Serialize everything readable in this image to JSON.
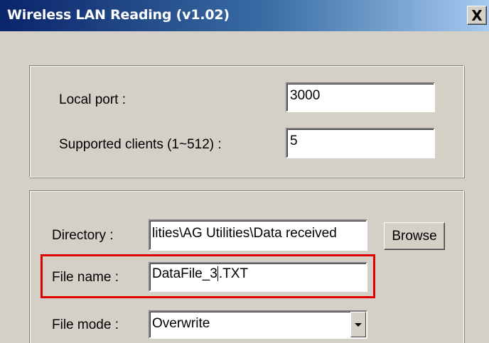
{
  "window": {
    "title": "Wireless LAN Reading (v1.02)",
    "close_glyph": "X"
  },
  "network": {
    "local_port_label": "Local port :",
    "local_port_value": "3000",
    "clients_label": "Supported clients (1~512) :",
    "clients_value": "5"
  },
  "file": {
    "directory_label": "Directory :",
    "directory_value": "lities\\AG Utilities\\Data received",
    "browse_label": "Browse",
    "filename_label": "File name :",
    "filename_before_caret": "DataFile_3",
    "filename_after_caret": ".TXT",
    "filemode_label": "File mode :",
    "filemode_value": "Overwrite"
  },
  "colors": {
    "highlight": "#e00000",
    "title_start": "#0a246a",
    "title_end": "#a6caf0"
  }
}
